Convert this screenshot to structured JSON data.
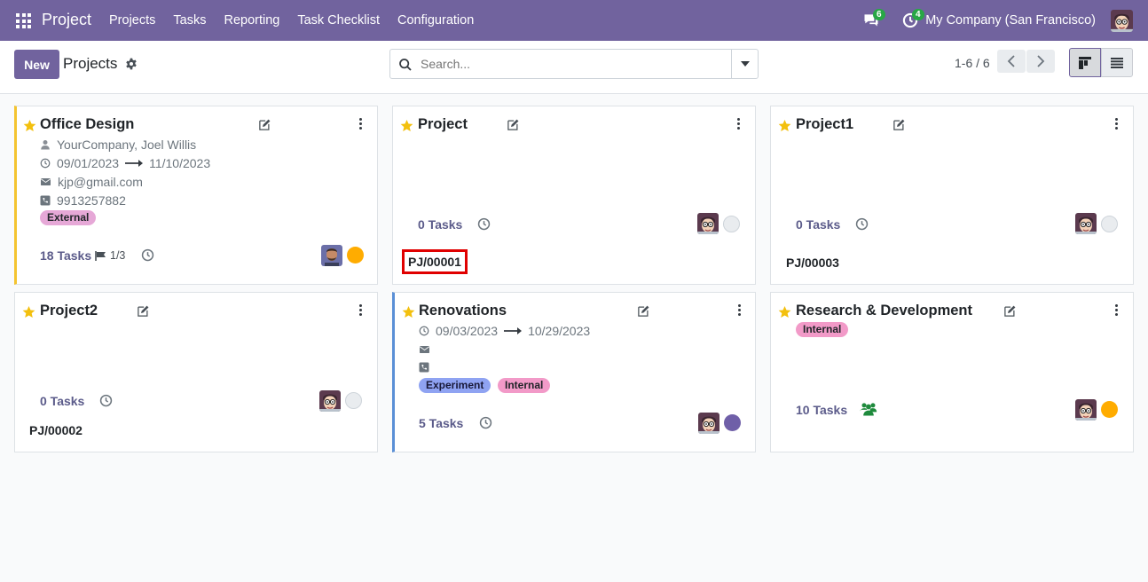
{
  "navbar": {
    "app_title": "Project",
    "menu": [
      "Projects",
      "Tasks",
      "Reporting",
      "Task Checklist",
      "Configuration"
    ],
    "messages_count": "6",
    "activities_count": "4",
    "company": "My Company (San Francisco)"
  },
  "control": {
    "new_label": "New",
    "breadcrumb": "Projects",
    "search_placeholder": "Search...",
    "pager": "1-6 / 6"
  },
  "colors": {
    "brand": "#71639e",
    "status_orange": "#ffac00",
    "status_purple": "#6f5fa8",
    "status_grey": "#e9ecef",
    "highlight": "#e00000"
  },
  "cards": [
    {
      "title": "Office Design",
      "customer": "YourCompany, Joel Willis",
      "date_start": "09/01/2023",
      "date_end": "11/10/2023",
      "email": "kjp@gmail.com",
      "phone": "9913257882",
      "tags": [
        "External"
      ],
      "tasks": "18 Tasks",
      "milestones": "1/3"
    },
    {
      "title": "Project",
      "tasks": "0 Tasks",
      "ref": "PJ/00001"
    },
    {
      "title": "Project1",
      "tasks": "0 Tasks",
      "ref": "PJ/00003"
    },
    {
      "title": "Project2",
      "tasks": "0 Tasks",
      "ref": "PJ/00002"
    },
    {
      "title": "Renovations",
      "date_start": "09/03/2023",
      "date_end": "10/29/2023",
      "tags": [
        "Experiment",
        "Internal"
      ],
      "tasks": "5 Tasks"
    },
    {
      "title": "Research & Development",
      "tags": [
        "Internal"
      ],
      "tasks": "10 Tasks"
    }
  ]
}
